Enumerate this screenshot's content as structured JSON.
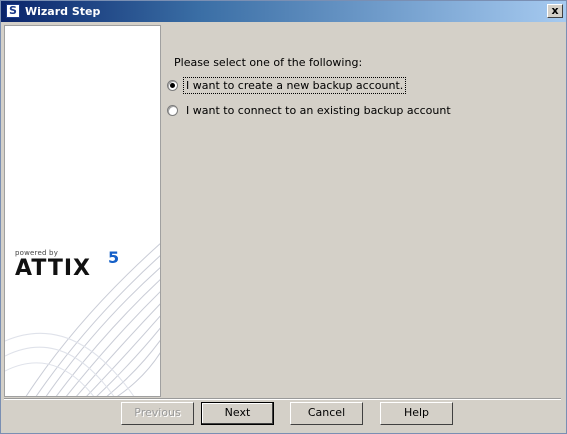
{
  "window": {
    "title": "Wizard Step",
    "close_label": "x"
  },
  "side_panel": {
    "powered_by": "powered by",
    "logo_text": "ATTIX",
    "logo_superscript": "5"
  },
  "main": {
    "prompt": "Please select one of the following:",
    "options": [
      {
        "label": "I want to create a new backup account.",
        "selected": true
      },
      {
        "label": "I want to connect to an existing backup account",
        "selected": false
      }
    ]
  },
  "buttons": {
    "previous": "Previous",
    "next": "Next",
    "cancel": "Cancel",
    "help": "Help"
  }
}
